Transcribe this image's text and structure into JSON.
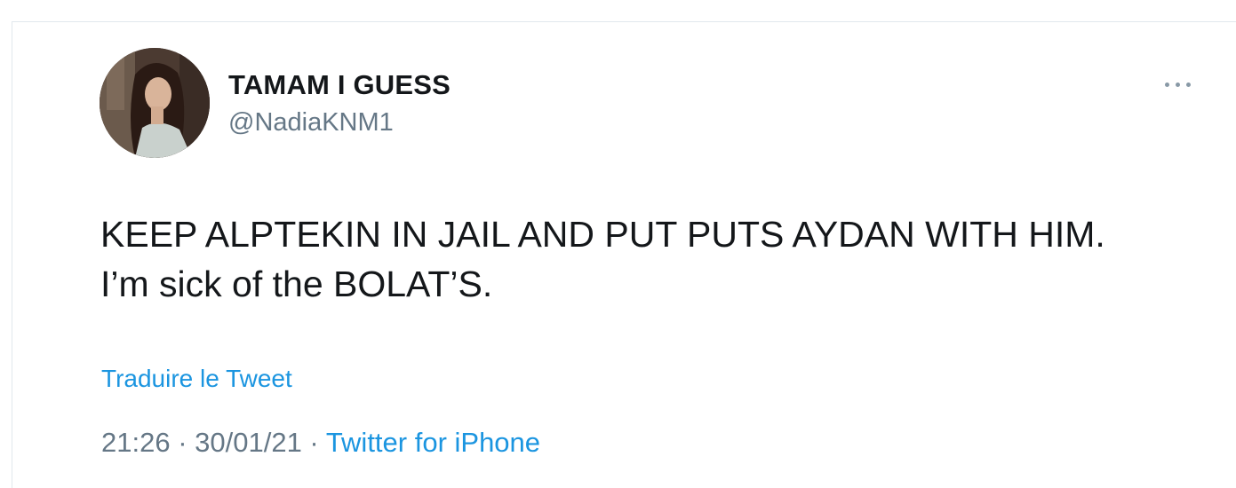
{
  "tweet": {
    "display_name": "TAMAM I GUESS",
    "handle": "@NadiaKNM1",
    "text_lines": [
      "KEEP ALPTEKIN IN JAIL AND PUT PUTS AYDAN WITH HIM.",
      "I’m sick of the BOLAT’S."
    ],
    "translate_label": "Traduire le Tweet",
    "time": "21:26",
    "separator": " · ",
    "date": "30/01/21",
    "source": "Twitter for iPhone"
  },
  "icons": {
    "more": "more-horizontal-icon"
  },
  "colors": {
    "link": "#1b95e0",
    "secondary_text": "#657786",
    "primary_text": "#14171a",
    "border": "#e1e8ed"
  }
}
